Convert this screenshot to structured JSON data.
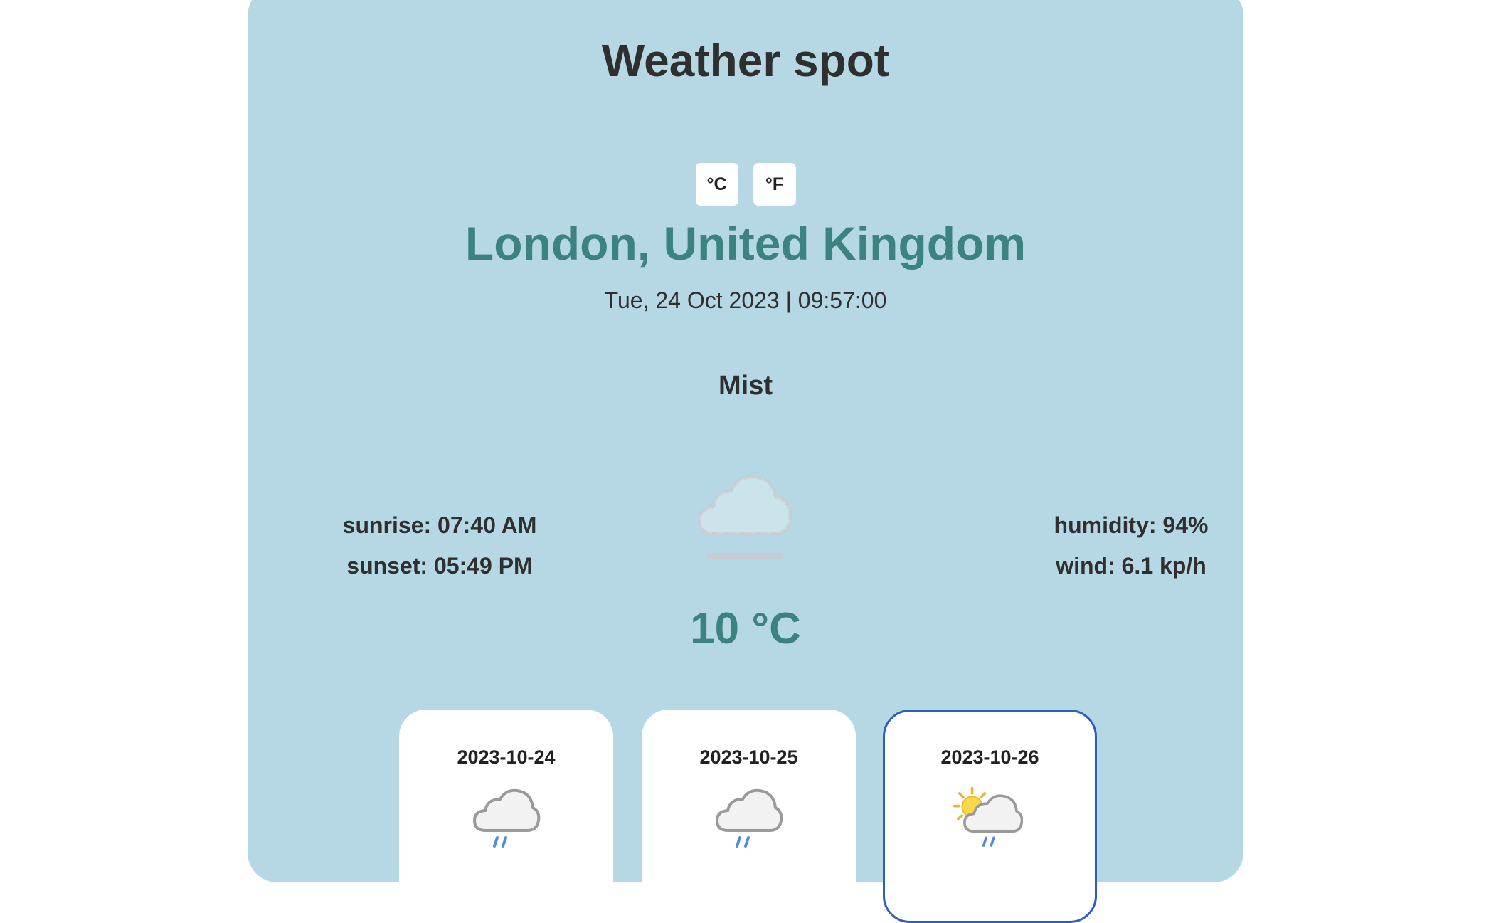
{
  "app": {
    "title": "Weather spot"
  },
  "units": {
    "celsius_label": "°C",
    "fahrenheit_label": "°F"
  },
  "location": {
    "city": "London, United Kingdom",
    "datetime": "Tue, 24 Oct 2023 | 09:57:00"
  },
  "current": {
    "condition": "Mist",
    "icon": "mist-cloud-icon",
    "sunrise": "sunrise: 07:40 AM",
    "sunset": "sunset: 05:49 PM",
    "humidity": "humidity: 94%",
    "wind": "wind: 6.1 kp/h",
    "temperature": "10 °C"
  },
  "forecast": [
    {
      "date": "2023-10-24",
      "icon": "rain-cloud-icon"
    },
    {
      "date": "2023-10-25",
      "icon": "rain-cloud-icon"
    },
    {
      "date": "2023-10-26",
      "icon": "sun-cloud-rain-icon",
      "selected": true
    }
  ],
  "colors": {
    "card_background": "#b6d8e4",
    "accent": "#3a8380",
    "selected_border": "#2a5fbf"
  }
}
